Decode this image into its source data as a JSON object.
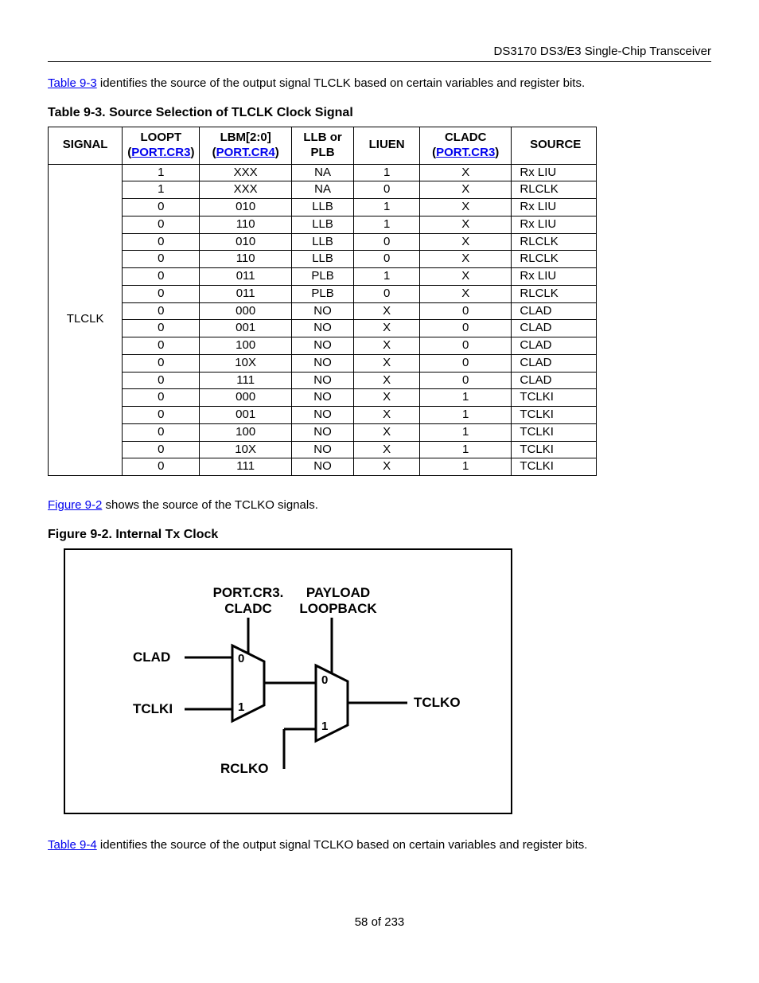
{
  "header": {
    "doc_title": "DS3170 DS3/E3 Single-Chip Transceiver"
  },
  "intro1": {
    "link": "Table 9-3",
    "rest": " identifies the source of the output signal TLCLK based on certain variables and register bits."
  },
  "table": {
    "caption": "Table 9-3. Source Selection of TLCLK Clock Signal",
    "headers": {
      "signal": "SIGNAL",
      "loopt_top": "LOOPT",
      "loopt_link": "PORT.CR3",
      "lbm_top": "LBM[2:0]",
      "lbm_link": "PORT.CR4",
      "llb": "LLB or PLB",
      "liuen": "LIUEN",
      "cladc_top": "CLADC",
      "cladc_link": "PORT.CR3",
      "source": "SOURCE"
    },
    "signal_label": "TLCLK",
    "rows": [
      {
        "loopt": "1",
        "lbm": "XXX",
        "llb": "NA",
        "liuen": "1",
        "cladc": "X",
        "source": "Rx LIU"
      },
      {
        "loopt": "1",
        "lbm": "XXX",
        "llb": "NA",
        "liuen": "0",
        "cladc": "X",
        "source": "RLCLK"
      },
      {
        "loopt": "0",
        "lbm": "010",
        "llb": "LLB",
        "liuen": "1",
        "cladc": "X",
        "source": "Rx LIU"
      },
      {
        "loopt": "0",
        "lbm": "110",
        "llb": "LLB",
        "liuen": "1",
        "cladc": "X",
        "source": "Rx LIU"
      },
      {
        "loopt": "0",
        "lbm": "010",
        "llb": "LLB",
        "liuen": "0",
        "cladc": "X",
        "source": "RLCLK"
      },
      {
        "loopt": "0",
        "lbm": "110",
        "llb": "LLB",
        "liuen": "0",
        "cladc": "X",
        "source": "RLCLK"
      },
      {
        "loopt": "0",
        "lbm": "011",
        "llb": "PLB",
        "liuen": "1",
        "cladc": "X",
        "source": "Rx LIU"
      },
      {
        "loopt": "0",
        "lbm": "011",
        "llb": "PLB",
        "liuen": "0",
        "cladc": "X",
        "source": "RLCLK"
      },
      {
        "loopt": "0",
        "lbm": "000",
        "llb": "NO",
        "liuen": "X",
        "cladc": "0",
        "source": "CLAD"
      },
      {
        "loopt": "0",
        "lbm": "001",
        "llb": "NO",
        "liuen": "X",
        "cladc": "0",
        "source": "CLAD"
      },
      {
        "loopt": "0",
        "lbm": "100",
        "llb": "NO",
        "liuen": "X",
        "cladc": "0",
        "source": "CLAD"
      },
      {
        "loopt": "0",
        "lbm": "10X",
        "llb": "NO",
        "liuen": "X",
        "cladc": "0",
        "source": "CLAD"
      },
      {
        "loopt": "0",
        "lbm": "111",
        "llb": "NO",
        "liuen": "X",
        "cladc": "0",
        "source": "CLAD"
      },
      {
        "loopt": "0",
        "lbm": "000",
        "llb": "NO",
        "liuen": "X",
        "cladc": "1",
        "source": "TCLKI"
      },
      {
        "loopt": "0",
        "lbm": "001",
        "llb": "NO",
        "liuen": "X",
        "cladc": "1",
        "source": "TCLKI"
      },
      {
        "loopt": "0",
        "lbm": "100",
        "llb": "NO",
        "liuen": "X",
        "cladc": "1",
        "source": "TCLKI"
      },
      {
        "loopt": "0",
        "lbm": "10X",
        "llb": "NO",
        "liuen": "X",
        "cladc": "1",
        "source": "TCLKI"
      },
      {
        "loopt": "0",
        "lbm": "111",
        "llb": "NO",
        "liuen": "X",
        "cladc": "1",
        "source": "TCLKI"
      }
    ]
  },
  "intro2": {
    "link": "Figure 9-2",
    "rest": " shows the source of the TCLKO signals."
  },
  "figure": {
    "caption": "Figure 9-2. Internal Tx Clock",
    "labels": {
      "cladc_sel": "PORT.CR3.\nCLADC",
      "payload_sel": "PAYLOAD\nLOOPBACK",
      "clad": "CLAD",
      "tclki": "TCLKI",
      "rclko": "RCLKO",
      "tclko": "TCLKO",
      "zero": "0",
      "one": "1"
    }
  },
  "intro3": {
    "link": "Table 9-4",
    "rest": " identifies the source of the output signal TCLKO based on certain variables and register bits."
  },
  "footer": "58 of 233"
}
